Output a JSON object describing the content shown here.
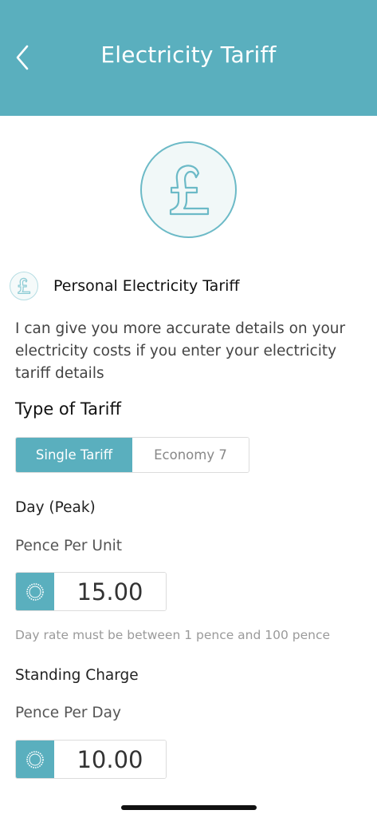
{
  "header": {
    "title": "Electricity Tariff",
    "back_icon": "chevron-left-icon",
    "background": "#5aafbe"
  },
  "hero": {
    "icon": "pound-icon"
  },
  "section": {
    "icon": "pound-icon",
    "title": "Personal Electricity Tariff",
    "description": "I can give you more accurate details on your electricity costs if you enter your electricity tariff details"
  },
  "tariff_type": {
    "heading": "Type of Tariff",
    "options": [
      "Single Tariff",
      "Economy 7"
    ],
    "selected": "Single Tariff"
  },
  "day_rate": {
    "title": "Day (Peak)",
    "unit_label": "Pence Per Unit",
    "value": "15.00",
    "hint": "Day rate must be between 1 pence and 100 pence"
  },
  "standing_charge": {
    "title": "Standing Charge",
    "unit_label": "Pence Per Day",
    "value": "10.00"
  },
  "colors": {
    "accent": "#5aafbe",
    "hint_text": "#9a9a9a"
  }
}
